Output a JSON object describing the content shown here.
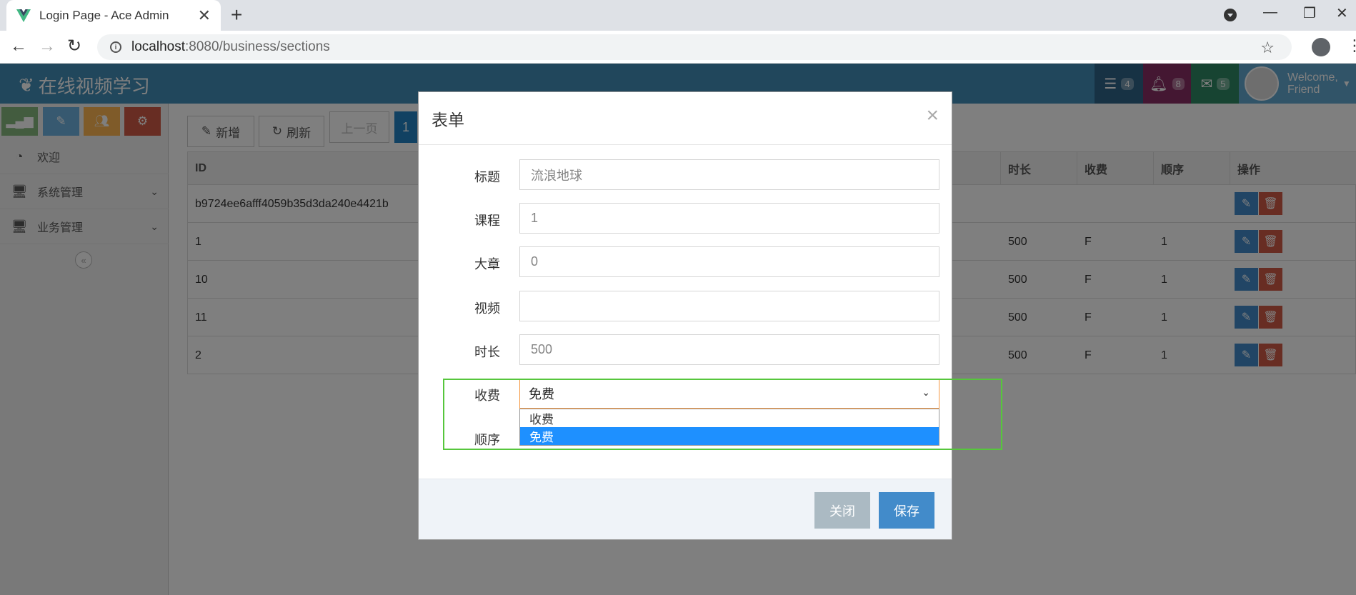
{
  "browser": {
    "tab_title": "Login Page - Ace Admin",
    "url_host": "localhost",
    "url_path": ":8080/business/sections"
  },
  "app": {
    "brand": "在线视频学习",
    "header": {
      "tasks_count": "4",
      "notifications_count": "8",
      "messages_count": "5",
      "welcome_line1": "Welcome,",
      "welcome_line2": "Friend"
    },
    "sidebar": {
      "items": [
        {
          "label": "欢迎"
        },
        {
          "label": "系统管理"
        },
        {
          "label": "业务管理"
        }
      ]
    },
    "toolbar": {
      "add_label": "新增",
      "refresh_label": "刷新",
      "prev_label": "上一页",
      "current_page": "1"
    },
    "table": {
      "headers": {
        "id": "ID",
        "duration": "时长",
        "charge": "收费",
        "order": "顺序",
        "action": "操作"
      },
      "rows": [
        {
          "id": "b9724ee6afff4059b35d3da240e4421b",
          "duration": "",
          "charge": "",
          "order": ""
        },
        {
          "id": "1",
          "duration": "500",
          "charge": "F",
          "order": "1"
        },
        {
          "id": "10",
          "duration": "500",
          "charge": "F",
          "order": "1"
        },
        {
          "id": "11",
          "duration": "500",
          "charge": "F",
          "order": "1"
        },
        {
          "id": "2",
          "duration": "500",
          "charge": "F",
          "order": "1"
        }
      ]
    }
  },
  "modal": {
    "title": "表单",
    "fields": {
      "title": {
        "label": "标题",
        "placeholder": "流浪地球"
      },
      "course": {
        "label": "课程",
        "value": "1"
      },
      "chapter": {
        "label": "大章",
        "value": "0"
      },
      "video": {
        "label": "视频",
        "value": ""
      },
      "duration": {
        "label": "时长",
        "value": "500"
      },
      "charge": {
        "label": "收费",
        "selected": "免费",
        "options": [
          "收费",
          "免费"
        ]
      },
      "order": {
        "label": "顺序"
      }
    },
    "buttons": {
      "close": "关闭",
      "save": "保存"
    }
  },
  "colors": {
    "header_bg": "#438eb9",
    "primary": "#428bca",
    "danger": "#d15b47",
    "highlight": "#56c63c",
    "option_selected": "#1e90ff"
  }
}
